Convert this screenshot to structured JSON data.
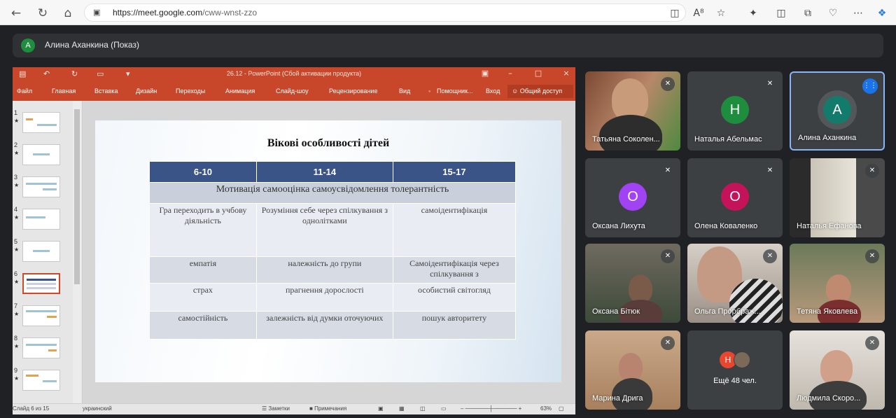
{
  "browser": {
    "url_host": "https://meet.google.com",
    "url_path": "/cww-wnst-zzo"
  },
  "presenter_bar": {
    "avatar_letter": "А",
    "name": "Алина Аханкина (Показ)"
  },
  "powerpoint": {
    "title": "26.12 - PowerPoint (Сбой активации продукта)",
    "ribbon_tabs": [
      "Файл",
      "Главная",
      "Вставка",
      "Дизайн",
      "Переходы",
      "Анимация",
      "Слайд-шоу",
      "Рецензирование",
      "Вид",
      "Помощник...",
      "Вход"
    ],
    "share_label": "Общий доступ",
    "thumbnails": [
      "1",
      "2",
      "3",
      "4",
      "5",
      "6",
      "7",
      "8",
      "9"
    ],
    "status": {
      "slide_info": "Слайд 6 из 15",
      "language": "украинский",
      "notes": "Заметки",
      "comments": "Примечания",
      "zoom": "63%"
    },
    "slide": {
      "title": "Вікові особливості дітей",
      "headers": [
        "6-10",
        "11-14",
        "15-17"
      ],
      "span_row": "Мотивація самооцінка самоусвідомлення толерантність",
      "rows": [
        [
          "Гра переходить в учбову діяльність",
          "Розуміння себе через спілкування з однолітками",
          "самоідентифікація"
        ],
        [
          "емпатія",
          "належність до групи",
          "Самоідентифікація через спілкування з"
        ],
        [
          "страх",
          "прагнення дорослості",
          "особистий світогляд"
        ],
        [
          "самостійність",
          "залежність від думки оточуючих",
          "пошук авторитету"
        ]
      ]
    }
  },
  "participants": [
    {
      "name": "Татьяна Соколен...",
      "type": "video"
    },
    {
      "name": "Наталья Абельмас",
      "type": "avatar",
      "letter": "Н",
      "color": "#1e8e3e"
    },
    {
      "name": "Алина Аханкина",
      "type": "avatar",
      "letter": "А",
      "color": "#137b6b"
    },
    {
      "name": "Оксана Лихута",
      "type": "avatar",
      "letter": "О",
      "color": "#a142f4"
    },
    {
      "name": "Олена Коваленко",
      "type": "avatar",
      "letter": "О",
      "color": "#c5135a"
    },
    {
      "name": "Наталья Ефанова",
      "type": "video"
    },
    {
      "name": "Оксана Бітюк",
      "type": "video"
    },
    {
      "name": "Ольга Прорбраж...",
      "type": "video"
    },
    {
      "name": "Тетяна Яковлева",
      "type": "video"
    },
    {
      "name": "Марина Дрига",
      "type": "video"
    },
    {
      "name": "Ещё 48 чел.",
      "type": "more",
      "letter": "Н"
    },
    {
      "name": "Людмила Скоро...",
      "type": "video"
    }
  ],
  "colors": {
    "ppt_accent": "#c8472a",
    "meet_bg": "#202124",
    "table_header": "#3b5487",
    "active_border": "#8ab4f8"
  },
  "icons": [
    "back-icon",
    "refresh-icon",
    "home-icon",
    "lock-icon",
    "camera-icon",
    "read-aloud-icon",
    "favorite-icon",
    "extensions-icon",
    "split-icon",
    "collections-icon",
    "performance-icon",
    "more-icon",
    "copilot-icon",
    "mic-off-icon",
    "speaking-icon"
  ]
}
